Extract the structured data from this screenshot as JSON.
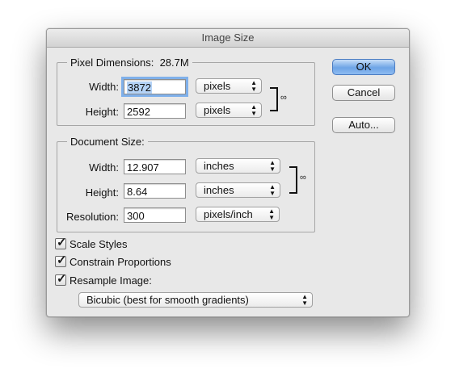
{
  "dialog": {
    "title": "Image Size"
  },
  "pixel_dimensions": {
    "legend": "Pixel Dimensions:",
    "size": "28.7M",
    "width": {
      "label": "Width:",
      "value": "3872",
      "unit": "pixels"
    },
    "height": {
      "label": "Height:",
      "value": "2592",
      "unit": "pixels"
    }
  },
  "document_size": {
    "legend": "Document Size:",
    "width": {
      "label": "Width:",
      "value": "12.907",
      "unit": "inches"
    },
    "height": {
      "label": "Height:",
      "value": "8.64",
      "unit": "inches"
    },
    "resolution": {
      "label": "Resolution:",
      "value": "300",
      "unit": "pixels/inch"
    }
  },
  "buttons": {
    "ok": "OK",
    "cancel": "Cancel",
    "auto": "Auto..."
  },
  "options": {
    "scale_styles": {
      "label": "Scale Styles",
      "checked": true
    },
    "constrain_proportions": {
      "label": "Constrain Proportions",
      "checked": true
    },
    "resample_image": {
      "label": "Resample Image:",
      "checked": true
    }
  },
  "resample_method": "Bicubic (best for smooth gradients)",
  "icons": {
    "link": "chain-link-icon",
    "checkmark": "checkmark-icon",
    "popup_arrows": "updown-arrows-icon"
  },
  "colors": {
    "default_button": "#6ea4e6",
    "selection": "#b4d3f7"
  }
}
